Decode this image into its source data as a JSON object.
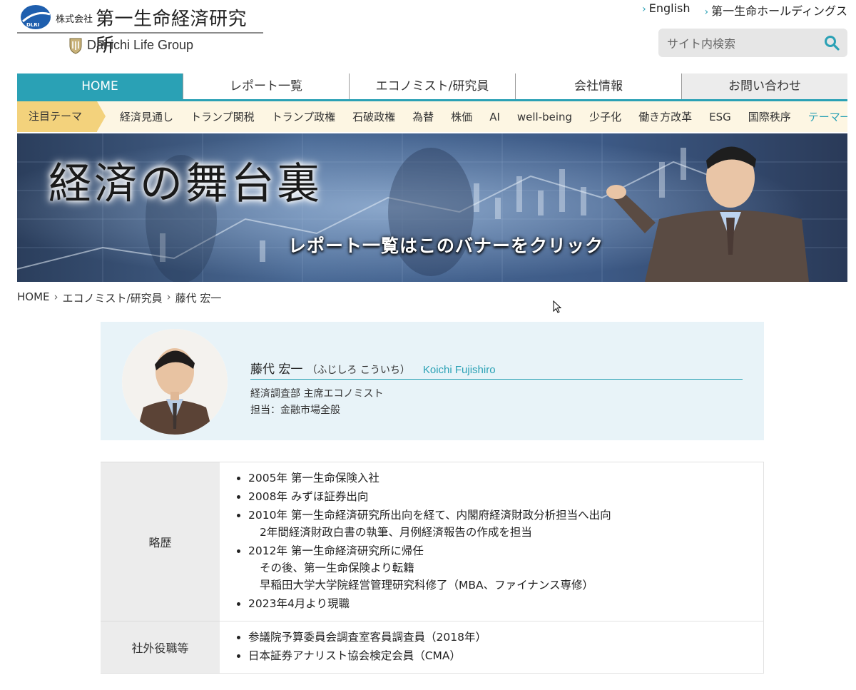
{
  "header": {
    "corp_prefix": "株式会社",
    "corp_name": "第一生命経済研究所",
    "logo_badge": "DLRI",
    "group_name": "Dai-ichi Life Group",
    "links": [
      "English",
      "第一生命ホールディングス"
    ],
    "search_placeholder": "サイト内検索"
  },
  "nav": {
    "items": [
      "HOME",
      "レポート一覧",
      "エコノミスト/研究員",
      "会社情報",
      "お問い合わせ"
    ],
    "active_index": 0
  },
  "themes": {
    "label": "注目テーマ",
    "items": [
      "経済見通し",
      "トランプ関税",
      "トランプ政権",
      "石破政権",
      "為替",
      "株価",
      "AI",
      "well-being",
      "少子化",
      "働き方改革",
      "ESG",
      "国際秩序"
    ],
    "more": "テーマ一覧"
  },
  "banner": {
    "title": "経済の舞台裏",
    "cta": "レポート一覧はこのバナーをクリック"
  },
  "breadcrumb": [
    "HOME",
    "エコノミスト/研究員",
    "藤代 宏一"
  ],
  "profile": {
    "name": "藤代 宏一",
    "kana": "（ふじしろ こういち）",
    "roman": "Koichi Fujishiro",
    "department": "経済調査部 主席エコノミスト",
    "area": "担当：金融市場全般"
  },
  "career": {
    "label": "略歴",
    "items": [
      {
        "line": "2005年 第一生命保険入社",
        "sub": []
      },
      {
        "line": "2008年 みずほ証券出向",
        "sub": []
      },
      {
        "line": "2010年 第一生命経済研究所出向を経て、内閣府経済財政分析担当へ出向",
        "sub": [
          "2年間経済財政白書の執筆、月例経済報告の作成を担当"
        ]
      },
      {
        "line": "2012年 第一生命経済研究所に帰任",
        "sub": [
          "その後、第一生命保険より転籍",
          "早稲田大学大学院経営管理研究科修了（MBA、ファイナンス専修）"
        ]
      },
      {
        "line": "2023年4月より現職",
        "sub": []
      }
    ]
  },
  "outside": {
    "label": "社外役職等",
    "items": [
      "参議院予算委員会調査室客員調査員（2018年）",
      "日本証券アナリスト協会検定会員（CMA）"
    ]
  },
  "colors": {
    "accent": "#2aa1b5",
    "theme_label_bg": "#f3d27c",
    "theme_bar_bg": "#fdf6e3",
    "profile_bg": "#e8f3f8"
  }
}
